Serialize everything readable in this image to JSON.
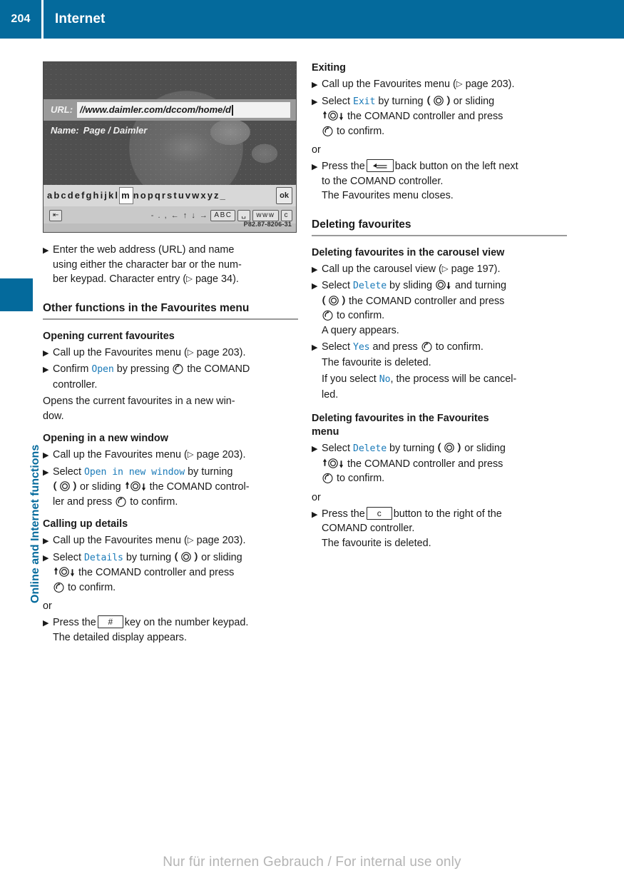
{
  "header": {
    "page_number": "204",
    "title": "Internet",
    "accent_color": "#046a9c"
  },
  "sidebar": {
    "chapter_label": "Online and Internet functions"
  },
  "figure": {
    "url_label": "URL:",
    "url_value": "//www.daimler.com/dccom/home/d",
    "name_label": "Name:",
    "name_value": "Page / Daimler",
    "char_bar_left": "abcdefghijkl",
    "char_bar_selected": "m",
    "char_bar_right": "nopqrstuvwxyz_",
    "ok_button": "ok",
    "toolbar_symbols": "- . , ← ↑ ↓ →",
    "toolbar_keys": [
      "ABC",
      "␣",
      "ᴡᴡᴡ",
      "c"
    ],
    "back_key": "⇤",
    "image_ref": "P82.87-8206-31"
  },
  "left_column": {
    "intro_step": {
      "line1": "Enter the web address (URL) and name",
      "line2": "using either the character bar or the num-",
      "line3_pre": "ber keypad. Character entry (",
      "line3_ref": "page 34",
      "line3_post": ")."
    },
    "section_heading": "Other functions in the Favourites menu",
    "sub1": {
      "heading": "Opening current favourites",
      "step1_pre": "Call up the Favourites menu (",
      "step1_ref": "page 203",
      "step1_post": ").",
      "step2_a": "Confirm",
      "step2_mono": "Open",
      "step2_b": "by pressing",
      "step2_c": "the COMAND",
      "step2_d": "controller.",
      "note1": "Opens the current favourites in a new win-",
      "note2": "dow."
    },
    "sub2": {
      "heading": "Opening in a new window",
      "step1_pre": "Call up the Favourites menu (",
      "step1_ref": "page 203",
      "step1_post": ").",
      "step2_a": "Select",
      "step2_mono": "Open in new window",
      "step2_b": "by turning",
      "step2_c": "or sliding",
      "step2_d": "the COMAND control-",
      "step2_e": "ler and press",
      "step2_f": "to confirm."
    },
    "sub3": {
      "heading": "Calling up details",
      "step1_pre": "Call up the Favourites menu (",
      "step1_ref": "page 203",
      "step1_post": ").",
      "step2_a": "Select",
      "step2_mono": "Details",
      "step2_b": "by turning",
      "step2_c": "or sliding",
      "step2_d": "the COMAND controller and press",
      "step2_e": "to confirm.",
      "or": "or",
      "step3_a": "Press the",
      "step3_key": "#",
      "step3_b": "key on the number keypad.",
      "step3_c": "The detailed display appears."
    }
  },
  "right_column": {
    "sub1": {
      "heading": "Exiting",
      "step1_pre": "Call up the Favourites menu (",
      "step1_ref": "page 203",
      "step1_post": ").",
      "step2_a": "Select",
      "step2_mono": "Exit",
      "step2_b": "by turning",
      "step2_c": "or sliding",
      "step2_d": "the COMAND controller and press",
      "step2_e": "to confirm.",
      "or": "or",
      "step3_a": "Press the",
      "step3_b": "back button on the left next",
      "step3_c": "to the COMAND controller.",
      "step3_d": "The Favourites menu closes."
    },
    "section_heading": "Deleting favourites",
    "sub2": {
      "heading": "Deleting favourites in the carousel view",
      "step1_pre": "Call up the carousel view (",
      "step1_ref": "page 197",
      "step1_post": ").",
      "step2_a": "Select",
      "step2_mono": "Delete",
      "step2_b": "by sliding",
      "step2_c": "and turning",
      "step2_d": "the COMAND controller and press",
      "step2_e": "to confirm.",
      "step2_f": "A query appears.",
      "step3_a": "Select",
      "step3_mono": "Yes",
      "step3_b": "and press",
      "step3_c": "to confirm.",
      "step3_d": "The favourite is deleted.",
      "note_a": "If you select",
      "note_mono": "No",
      "note_b": ", the process will be cancel-",
      "note_c": "led."
    },
    "sub3": {
      "heading_line1": "Deleting favourites in the Favourites",
      "heading_line2": "menu",
      "step1_a": "Select",
      "step1_mono": "Delete",
      "step1_b": "by turning",
      "step1_c": "or sliding",
      "step1_d": "the COMAND controller and press",
      "step1_e": "to confirm.",
      "or": "or",
      "step2_a": "Press the",
      "step2_key": "c",
      "step2_b": "button to the right of the",
      "step2_c": "COMAND controller.",
      "step2_d": "The favourite is deleted."
    }
  },
  "footer": {
    "watermark": "Nur für internen Gebrauch / For internal use only"
  },
  "colors": {
    "accent": "#046a9c",
    "mono_blue": "#1a7ab8",
    "rule_gray": "#9a9a9a"
  }
}
